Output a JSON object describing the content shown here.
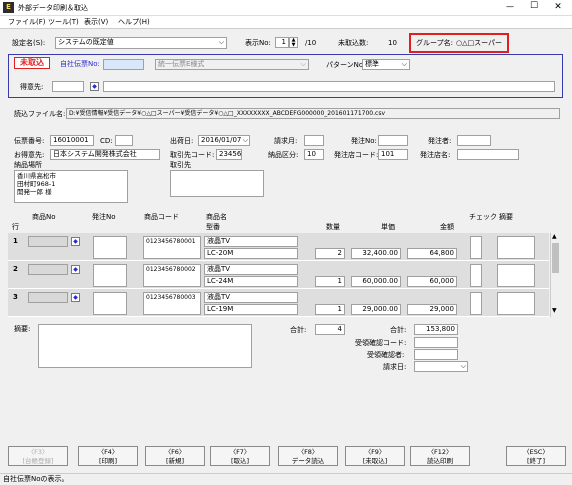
{
  "window": {
    "title": "外部データ印刷＆取込",
    "minimize": "—",
    "maximize": "☐",
    "close": "✕"
  },
  "menu": [
    "ファイル(F)",
    "ツール(T)",
    "表示(V)",
    "ヘルプ(H)"
  ],
  "top": {
    "setting_label": "設定名(S):",
    "setting_value": "システムの既定値",
    "display_label": "表示No:",
    "display_value": "1",
    "display_total": "/10",
    "unimported_label": "未取込数:",
    "unimported_value": "10",
    "group_label": "グループ名:",
    "group_value": "○△□スーパー"
  },
  "import_box": {
    "status": "未取込",
    "slip_label": "自社伝票No:",
    "slip_value": "",
    "slip_type": "統一伝票E様式",
    "pattern_label": "パターンNo:",
    "pattern_value": "標準",
    "customer_label": "得意先:",
    "customer_value": ""
  },
  "file": {
    "label": "読込ファイル名:",
    "path": "D:¥受信情報¥受信データ¥○△□スーパー¥受信データ¥○△□_XXXXXXXX_ABCDEFG000000_201601171700.csv"
  },
  "header": {
    "slip_no_label": "伝票番号:",
    "slip_no": "16010001",
    "cd_label": "CD:",
    "cd": "",
    "ship_date_label": "出荷日:",
    "ship_date": "2016/01/07",
    "bill_month_label": "請求月:",
    "bill_month": "",
    "order_no_label": "発注No:",
    "order_no": "",
    "orderer_label": "発注者:",
    "orderer": "",
    "customer_label": "お得意先:",
    "customer": "日本システム開発株式会社",
    "trade_code_label": "取引先コード:",
    "trade_code": "23456",
    "delivery_cat_label": "納品区分:",
    "delivery_cat": "10",
    "order_store_code_label": "発注店コード:",
    "order_store_code": "101",
    "order_store_name_label": "発注店名:",
    "order_store_name": "",
    "delivery_place_label": "納品場所",
    "delivery_place": [
      "香川県高松市",
      "田村町968-1",
      "開発一郎 様"
    ],
    "trade_label": "取引先"
  },
  "columns": {
    "row": "行",
    "product_no": "商品No",
    "order_no": "発注No",
    "product_code": "商品コード",
    "product_name": "商品名",
    "model": "型番",
    "qty": "数量",
    "price": "単価",
    "amount": "金額",
    "check": "チェック",
    "remarks": "摘要"
  },
  "rows": [
    {
      "row": "1",
      "code": "0123456780001",
      "name": "液晶TV",
      "model": "LC-20M",
      "qty": "2",
      "price": "32,400.00",
      "amount": "64,800"
    },
    {
      "row": "2",
      "code": "0123456780002",
      "name": "液晶TV",
      "model": "LC-24M",
      "qty": "1",
      "price": "60,000.00",
      "amount": "60,000"
    },
    {
      "row": "3",
      "code": "0123456780003",
      "name": "液晶TV",
      "model": "LC-19M",
      "qty": "1",
      "price": "29,000.00",
      "amount": "29,000"
    }
  ],
  "footer": {
    "remarks_label": "摘要:",
    "total_qty_label": "合計:",
    "total_qty": "4",
    "total_amount_label": "合計:",
    "total_amount": "153,800",
    "recv_code_label": "受領確認コード:",
    "recv_person_label": "受領確認者:",
    "bill_date_label": "請求日:"
  },
  "fkeys": [
    {
      "key": "〈F3〉",
      "label": "[台帳登録]"
    },
    {
      "key": "〈F4〉",
      "label": "[印刷]"
    },
    {
      "key": "〈F6〉",
      "label": "[新規]"
    },
    {
      "key": "〈F7〉",
      "label": "[取込]"
    },
    {
      "key": "〈F8〉",
      "label": "データ読込"
    },
    {
      "key": "〈F9〉",
      "label": "[未取込]"
    },
    {
      "key": "〈F12〉",
      "label": "読込印刷"
    },
    {
      "key": "〈ESC〉",
      "label": "[終了]"
    }
  ],
  "status": "自社伝票Noの表示。",
  "colors": {
    "accent_red": "#e0201e",
    "import_border": "#3a3ab0"
  }
}
